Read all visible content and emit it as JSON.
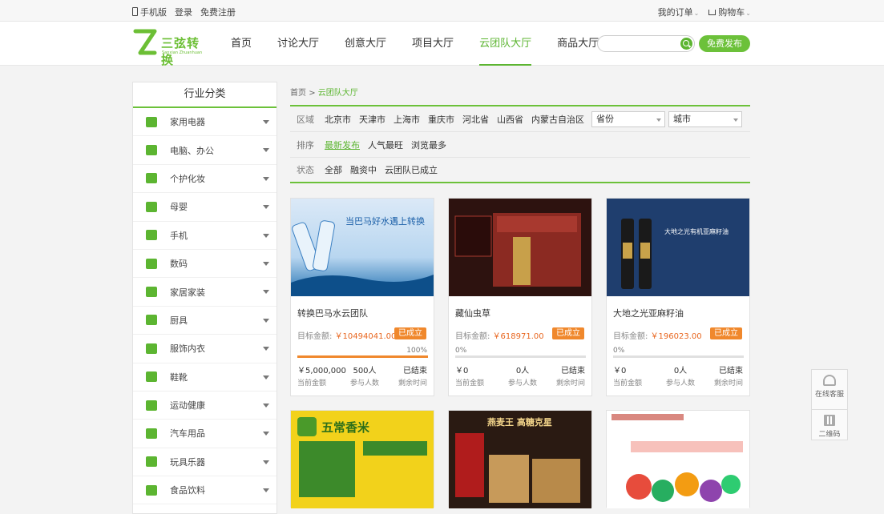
{
  "topbar": {
    "mobile": "手机版",
    "login": "登录",
    "register": "免费注册",
    "orders": "我的订单",
    "cart": "购物车"
  },
  "logo": {
    "name": "三弦转换",
    "sub": "Sanxian Zhuanhuan"
  },
  "nav": [
    {
      "label": "首页"
    },
    {
      "label": "讨论大厅"
    },
    {
      "label": "创意大厅"
    },
    {
      "label": "项目大厅"
    },
    {
      "label": "云团队大厅"
    },
    {
      "label": "商品大厅"
    }
  ],
  "search": {
    "placeholder": ""
  },
  "publish_label": "免费发布",
  "sidebar": {
    "title": "行业分类",
    "items": [
      {
        "label": "家用电器",
        "icon": "appliance-icon"
      },
      {
        "label": "电脑、办公",
        "icon": "computer-icon"
      },
      {
        "label": "个护化妆",
        "icon": "cosmetics-icon"
      },
      {
        "label": "母婴",
        "icon": "baby-bottle-icon"
      },
      {
        "label": "手机",
        "icon": "phone-icon"
      },
      {
        "label": "数码",
        "icon": "camera-icon"
      },
      {
        "label": "家居家装",
        "icon": "sofa-icon"
      },
      {
        "label": "厨具",
        "icon": "pot-icon"
      },
      {
        "label": "服饰内衣",
        "icon": "shirt-icon"
      },
      {
        "label": "鞋靴",
        "icon": "shoe-icon"
      },
      {
        "label": "运动健康",
        "icon": "treadmill-icon"
      },
      {
        "label": "汽车用品",
        "icon": "car-icon"
      },
      {
        "label": "玩具乐器",
        "icon": "rocking-horse-icon"
      },
      {
        "label": "食品饮料",
        "icon": "food-icon"
      }
    ]
  },
  "breadcrumb": {
    "home": "首页",
    "sep": ">",
    "current": "云团队大厅"
  },
  "filters": {
    "region": {
      "label": "区域",
      "options": [
        "北京市",
        "天津市",
        "上海市",
        "重庆市",
        "河北省",
        "山西省",
        "内蒙古自治区"
      ],
      "province": "省份",
      "city": "城市"
    },
    "sort": {
      "label": "排序",
      "options": [
        "最新发布",
        "人气最旺",
        "浏览最多"
      ]
    },
    "status": {
      "label": "状态",
      "options": [
        "全部",
        "融资中",
        "云团队已成立"
      ]
    }
  },
  "cards": [
    {
      "title": "转换巴马水云团队",
      "target_label": "目标金额:",
      "target": "￥10494041.00",
      "badge": "已成立",
      "progress": 100,
      "progress_text": "100%",
      "current": "￥5,000,000",
      "current_label": "当前金额",
      "people": "500人",
      "people_label": "参与人数",
      "remain": "已结束",
      "remain_label": "剩余时间",
      "img_text": "当巴马好水遇上转换"
    },
    {
      "title": "藏仙虫草",
      "target_label": "目标金额:",
      "target": "￥618971.00",
      "badge": "已成立",
      "progress": 0,
      "progress_text": "0%",
      "current": "￥0",
      "current_label": "当前金额",
      "people": "0人",
      "people_label": "参与人数",
      "remain": "已结束",
      "remain_label": "剩余时间",
      "img_text": ""
    },
    {
      "title": "大地之光亚麻籽油",
      "target_label": "目标金额:",
      "target": "￥196023.00",
      "badge": "已成立",
      "progress": 0,
      "progress_text": "0%",
      "current": "￥0",
      "current_label": "当前金额",
      "people": "0人",
      "people_label": "参与人数",
      "remain": "已结束",
      "remain_label": "剩余时间",
      "img_text": "大地之光有机亚麻籽油"
    }
  ],
  "cards_row2": [
    {
      "img_text": "五常香米"
    },
    {
      "img_text": "燕麦王 高糖克星"
    },
    {
      "img_text": ""
    }
  ],
  "float": {
    "service": "在线客服",
    "qrcode": "二维码"
  }
}
